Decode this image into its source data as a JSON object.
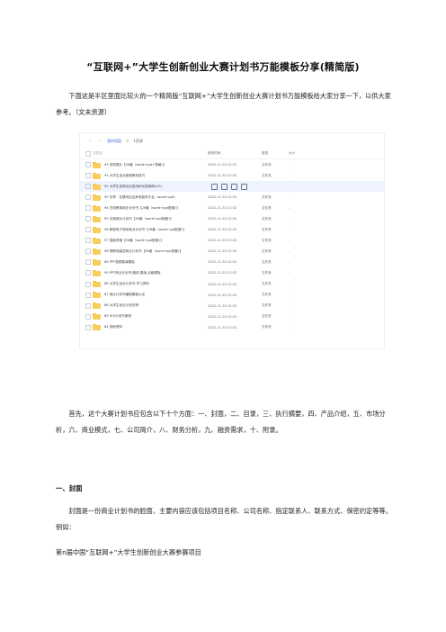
{
  "doc": {
    "title": "“互联网+”大学生创新创业大赛计划书万能模板分享(精简版)",
    "intro": "下面这是半区里面比较火的一个精简版“互联网+”大学生创新创业大赛计划书万能模板给大家分享一下，以供大家参考。（文末资源）",
    "para2": "首先，这个大赛计划书应包含以下十个方面：一、封面，二、目录，三、执行摘要，四、产品介绍，五、市场分析，六、商业模式，七、公司简介，八、财务分析，九、融资需求，十、附录。",
    "heading1": "一、封面",
    "para3": "封面是一份商业计划书的脸面，主要内容应该包括项目名称、公司名称、指定联系人、联系方式、保密约定等等。例如：",
    "para4": "第n届中国“互联网+”大学生创新创业大赛参赛项目"
  },
  "screenshot": {
    "nav": {
      "back": "‹",
      "forward": "›",
      "path_root": "我的网盘",
      "path_sep": ">",
      "path_current": "1资源"
    },
    "columns": {
      "name": "文件名",
      "date": "修改时间",
      "type": "类型",
      "size": "大小"
    },
    "rows": [
      {
        "name": "93 多样图片【26套（word+ppt+表格）】",
        "date": "2022-11-30 22:32",
        "type": "文件夹",
        "size": "-"
      },
      {
        "name": "91 大学生创业营销策划技巧",
        "date": "2022-11-30 22:32",
        "type": "文件夹",
        "size": "-"
      },
      {
        "name": "92 大学生创新创业挑战杯优秀案例(4G)",
        "date": "",
        "type": "",
        "size": "",
        "highlight": true
      },
      {
        "name": "90 乐界 · 互联网社区养老服务平台（word+ppt）",
        "date": "2022-11-30 22:32",
        "type": "文件夹",
        "size": "-"
      },
      {
        "name": "94 在线教育商业计划书【26套（word+ppt配套）】",
        "date": "2022-11-30 22:32",
        "type": "文件夹",
        "size": "-"
      },
      {
        "name": "95 花境商业计划书【26套（word+ppt配套）】",
        "date": "2022-11-30 22:32",
        "type": "文件夹",
        "size": "-"
      },
      {
        "name": "96 跨境电子商务商业计划书【26套（word+ppt配套）】",
        "date": "2022-11-30 22:32",
        "type": "文件夹",
        "size": "-"
      },
      {
        "name": "97 智能养殖【26套（word+ppt配套）】",
        "date": "2022-11-30 22:32",
        "type": "文件夹",
        "size": "-"
      },
      {
        "name": "98 物联网高层商业计划书【26套（word+ppt配套）】",
        "date": "2022-11-30 22:32",
        "type": "文件夹",
        "size": "-"
      },
      {
        "name": "89 PPT视频路演模板",
        "date": "2022-11-30 22:32",
        "type": "文件夹",
        "size": "-"
      },
      {
        "name": "90 PPT商业计划书-融资,路演,全套模板",
        "date": "2022-11-30 22:32",
        "type": "文件夹",
        "size": "-"
      },
      {
        "name": "88 大学生创业计划书 学习资料",
        "date": "2022-11-30 22:32",
        "type": "文件夹",
        "size": "-"
      },
      {
        "name": "87 商业计划书编制模板大全",
        "date": "2022-11-30 22:32",
        "type": "文件夹",
        "size": "-"
      },
      {
        "name": "86 大学生创业计划范例",
        "date": "2022-11-30 22:32",
        "type": "文件夹",
        "size": "-"
      },
      {
        "name": "85 ROI计划书案例",
        "date": "2022-11-30 22:31",
        "type": "文件夹",
        "size": "-"
      },
      {
        "name": "84 其他资料",
        "date": "2022-11-30 22:31",
        "type": "文件夹",
        "size": "-"
      }
    ]
  }
}
